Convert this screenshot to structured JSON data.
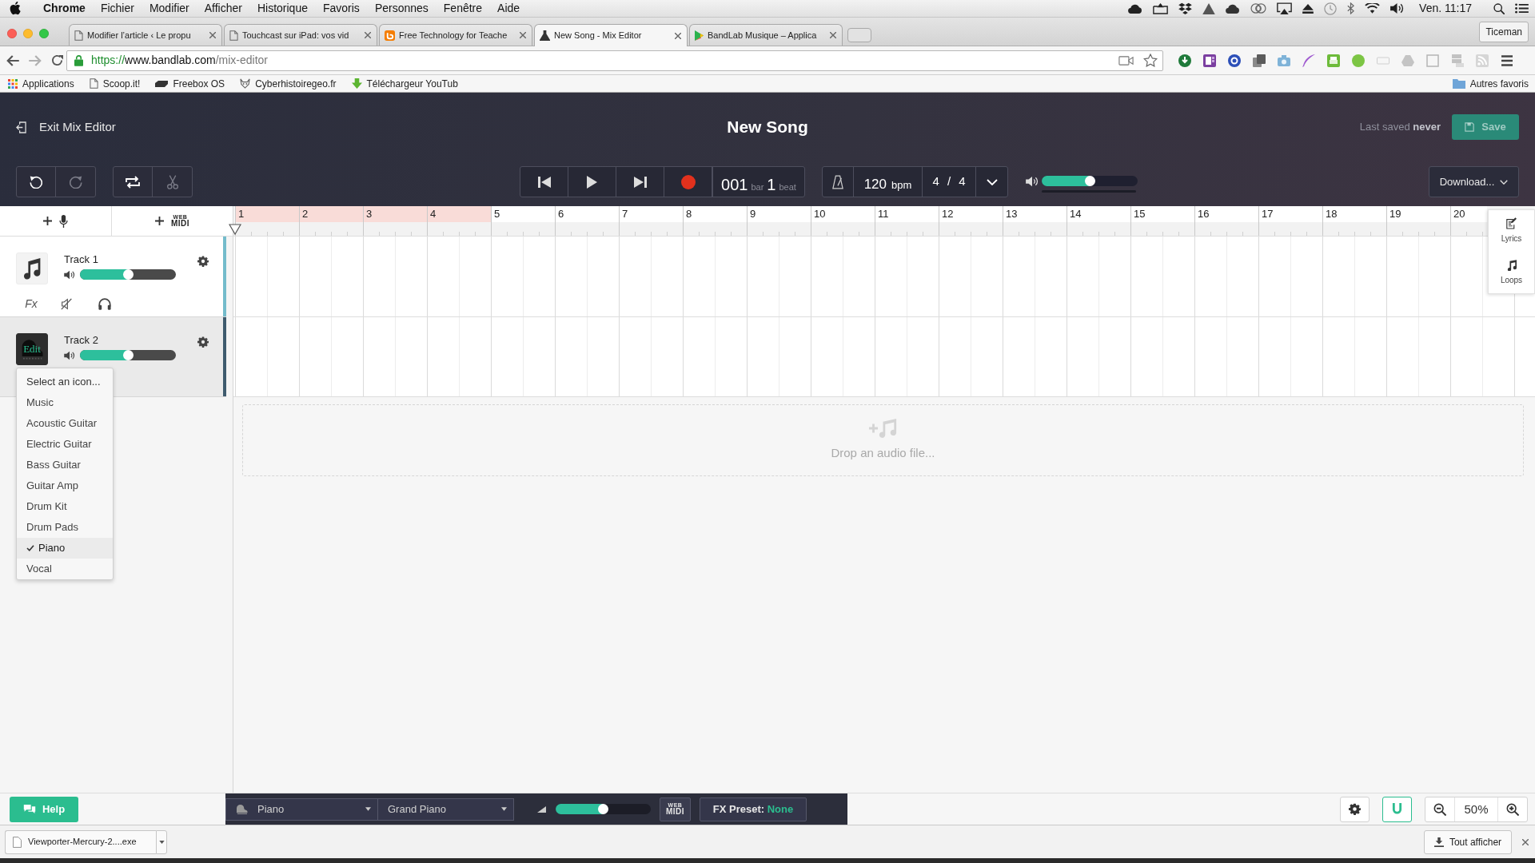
{
  "menubar": {
    "app": "Chrome",
    "menus": [
      "Fichier",
      "Modifier",
      "Afficher",
      "Historique",
      "Favoris",
      "Personnes",
      "Fenêtre",
      "Aide"
    ],
    "clock": "Ven. 11:17"
  },
  "browser": {
    "tabs": [
      {
        "title": "Modifier l’article ‹ Le propu",
        "selected": false
      },
      {
        "title": "Touchcast sur iPad: vos vid",
        "selected": false
      },
      {
        "title": "Free Technology for Teache",
        "selected": false
      },
      {
        "title": "New Song - Mix Editor",
        "selected": true
      },
      {
        "title": "BandLab Musique – Applica",
        "selected": false
      }
    ],
    "profile": "Ticeman",
    "address": {
      "scheme": "https://",
      "host": "www.bandlab.com",
      "path": "/mix-editor"
    },
    "bookmarks": [
      "Applications",
      "Scoop.it!",
      "Freebox OS",
      "Cyberhistoiregeo.fr",
      "Téléchargeur YouTub"
    ],
    "other_bookmarks": "Autres favoris"
  },
  "editor": {
    "exit": "Exit Mix Editor",
    "title": "New Song",
    "last_saved": "Last saved **never**",
    "save": {
      "label": "Save",
      "disabled": true
    },
    "edit_tools": [
      {
        "kind": "undo",
        "disabled": false
      },
      {
        "kind": "redo",
        "disabled": true
      }
    ],
    "clip_tools": [
      {
        "kind": "loop",
        "disabled": false
      },
      {
        "kind": "split",
        "disabled": true
      }
    ],
    "position": {
      "bar": "001",
      "bar_unit": "bar",
      "beat": "1",
      "beat_unit": "beat"
    },
    "tempo": "120",
    "tempo_unit": "bpm",
    "time_signature": "4 / 4",
    "master_volume": {
      "level": 0.5
    },
    "download": "Download..."
  },
  "tracks_panel": {
    "add_midi": {
      "web": "WEB",
      "midi": "MIDI"
    },
    "tracks": [
      {
        "name": "Track 1",
        "color": "#74bccb",
        "selected": false,
        "volume": {
          "level": 0.5
        },
        "fx": "Fx"
      },
      {
        "name": "Track 2",
        "icon_label": "Edit",
        "color": "#3e5b6e",
        "selected": true,
        "volume": {
          "level": 0.5
        }
      }
    ],
    "icon_menu": {
      "title": "Select an icon...",
      "items": [
        {
          "label": "Music",
          "selected": false
        },
        {
          "label": "Acoustic Guitar",
          "selected": false
        },
        {
          "label": "Electric Guitar",
          "selected": false
        },
        {
          "label": "Bass Guitar",
          "selected": false
        },
        {
          "label": "Guitar Amp",
          "selected": false
        },
        {
          "label": "Drum Kit",
          "selected": false
        },
        {
          "label": "Drum Pads",
          "selected": false
        },
        {
          "label": "Piano",
          "selected": true
        },
        {
          "label": "Vocal",
          "selected": false
        }
      ]
    }
  },
  "timeline": {
    "bars": [
      {
        "label": "1",
        "in_loop": true
      },
      {
        "label": "2",
        "in_loop": true
      },
      {
        "label": "3",
        "in_loop": true
      },
      {
        "label": "4",
        "in_loop": true
      },
      {
        "label": "5",
        "in_loop": false
      },
      {
        "label": "6",
        "in_loop": false
      },
      {
        "label": "7",
        "in_loop": false
      },
      {
        "label": "8",
        "in_loop": false
      },
      {
        "label": "9",
        "in_loop": false
      },
      {
        "label": "10",
        "in_loop": false
      },
      {
        "label": "11",
        "in_loop": false
      },
      {
        "label": "12",
        "in_loop": false
      },
      {
        "label": "13",
        "in_loop": false
      },
      {
        "label": "14",
        "in_loop": false
      },
      {
        "label": "15",
        "in_loop": false
      },
      {
        "label": "16",
        "in_loop": false
      },
      {
        "label": "17",
        "in_loop": false
      },
      {
        "label": "18",
        "in_loop": false
      },
      {
        "label": "19",
        "in_loop": false
      },
      {
        "label": "20",
        "in_loop": false
      }
    ],
    "drop_zone": "Drop an audio file...",
    "side_panel": [
      {
        "kind": "lyrics",
        "label": "Lyrics"
      },
      {
        "kind": "loops",
        "label": "Loops"
      }
    ]
  },
  "bottom_bar": {
    "help": "Help",
    "instrument": "Piano",
    "preset": "Grand Piano",
    "volume": {
      "level": 0.5
    },
    "midi": {
      "web": "WEB",
      "midi": "MIDI"
    },
    "fx_preset_label": "FX Preset:",
    "fx_preset_value": "None",
    "snap": true,
    "zoom": "50%"
  },
  "downloads": {
    "file": "Viewporter-Mercury-2....exe",
    "show_all": "Tout afficher"
  }
}
